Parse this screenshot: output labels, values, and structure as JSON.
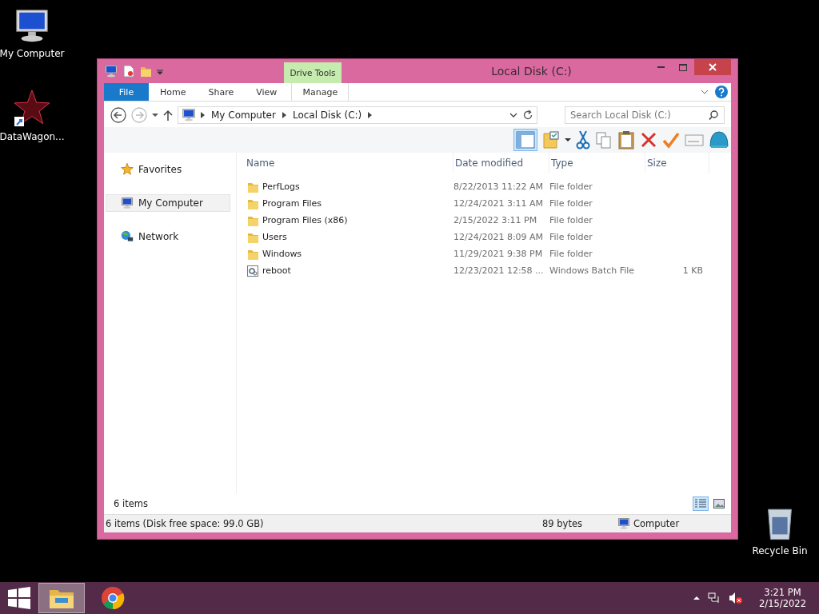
{
  "desktop_icons": [
    {
      "label": "My Computer",
      "kind": "computer"
    },
    {
      "label": "DataWagon...",
      "kind": "star"
    },
    {
      "label": "Recycle Bin",
      "kind": "bin"
    }
  ],
  "window": {
    "title": "Local Disk (C:)",
    "context_label": "Drive Tools",
    "ribbon_tabs": [
      {
        "label": "File",
        "kind": "file"
      },
      {
        "label": "Home",
        "kind": "plain"
      },
      {
        "label": "Share",
        "kind": "plain"
      },
      {
        "label": "View",
        "kind": "plain"
      },
      {
        "label": "Manage",
        "kind": "context"
      }
    ],
    "address": [
      "My Computer",
      "Local Disk (C:)"
    ],
    "search": {
      "placeholder": "Search Local Disk (C:)"
    },
    "nav": [
      {
        "label": "Favorites",
        "kind": "star",
        "selected": false
      },
      {
        "label": "My Computer",
        "kind": "computer",
        "selected": true
      },
      {
        "label": "Network",
        "kind": "network",
        "selected": false
      }
    ],
    "columns": [
      "Name",
      "Date modified",
      "Type",
      "Size"
    ],
    "rows": [
      {
        "kind": "folder",
        "name": "PerfLogs",
        "date": "8/22/2013 11:22 AM",
        "type": "File folder"
      },
      {
        "kind": "folder",
        "name": "Program Files",
        "date": "12/24/2021 3:11 AM",
        "type": "File folder"
      },
      {
        "kind": "folder",
        "name": "Program Files (x86)",
        "date": "2/15/2022 3:11 PM",
        "type": "File folder"
      },
      {
        "kind": "folder",
        "name": "Users",
        "date": "12/24/2021 8:09 AM",
        "type": "File folder"
      },
      {
        "kind": "folder",
        "name": "Windows",
        "date": "11/29/2021 9:38 PM",
        "type": "File folder"
      },
      {
        "kind": "batch",
        "name": "reboot",
        "date": "12/23/2021 12:58 ...",
        "type": "Windows Batch File",
        "size": "1 KB"
      }
    ],
    "item_count": "6 items",
    "status_bar": [
      "6 items (Disk free space: 99.0 GB)",
      "89 bytes",
      "Computer"
    ]
  },
  "taskbar": {
    "apps": [
      {
        "kind": "explorer",
        "selected": true
      },
      {
        "kind": "browser",
        "selected": false
      }
    ],
    "time": "3:21 PM",
    "date": "2/15/2022"
  }
}
